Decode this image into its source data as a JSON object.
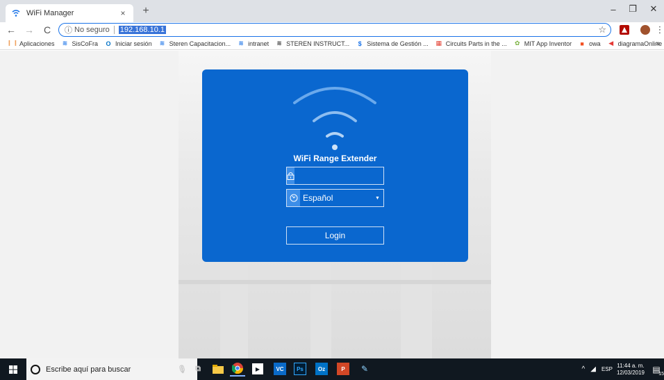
{
  "tab": {
    "title": "WiFi Manager",
    "close": "×",
    "new": "+"
  },
  "window": {
    "minimize": "–",
    "restore": "❐",
    "close": "✕"
  },
  "nav": {
    "back": "←",
    "forward": "→",
    "reload": "C"
  },
  "omnibox": {
    "info": "ⓘ",
    "security": "No seguro",
    "url": "192.168.10.1",
    "star": "☆"
  },
  "bookmarks": [
    {
      "label": "Aplicaciones",
      "icon": "apps-icon",
      "glyph": "⋮⋮",
      "color": "#e8710a"
    },
    {
      "label": "SisCoFra",
      "icon": "steren-icon",
      "glyph": "≋",
      "color": "#1a73e8"
    },
    {
      "label": "Iniciar sesión",
      "icon": "outlook-icon",
      "glyph": "O",
      "color": "#0072c6"
    },
    {
      "label": "Steren Capacitacion...",
      "icon": "steren-icon",
      "glyph": "≋",
      "color": "#1a73e8"
    },
    {
      "label": "intranet",
      "icon": "steren-icon",
      "glyph": "≋",
      "color": "#1a73e8"
    },
    {
      "label": "STEREN INSTRUCT...",
      "icon": "steren-icon",
      "glyph": "≋",
      "color": "#333333"
    },
    {
      "label": "Sistema de Gestión ...",
      "icon": "sg-icon",
      "glyph": "$",
      "color": "#1a73e8"
    },
    {
      "label": "Circuits Parts in the ...",
      "icon": "grid-icon",
      "glyph": "▦",
      "color": "#e34234"
    },
    {
      "label": "MIT App Inventor",
      "icon": "mit-icon",
      "glyph": "✿",
      "color": "#7cb342"
    },
    {
      "label": "owa",
      "icon": "windows-icon",
      "glyph": "■",
      "color": "#f25022"
    },
    {
      "label": "diagramaOnline",
      "icon": "diagrama-icon",
      "glyph": "◀",
      "color": "#e53935"
    }
  ],
  "bookmarks_more": "»",
  "login": {
    "device_name": "WiFi Range Extender",
    "password_value": "",
    "language_selected": "Español",
    "login_label": "Login"
  },
  "taskbar": {
    "search_placeholder": "Escribe aquí para buscar",
    "tray_chevron": "^",
    "language": "ESP",
    "time": "11:44 a. m.",
    "date": "12/03/2019",
    "notification_count": "15"
  },
  "colors": {
    "card": "#0a67cf",
    "accent": "#3d8ee8",
    "taskbar": "#101820"
  }
}
